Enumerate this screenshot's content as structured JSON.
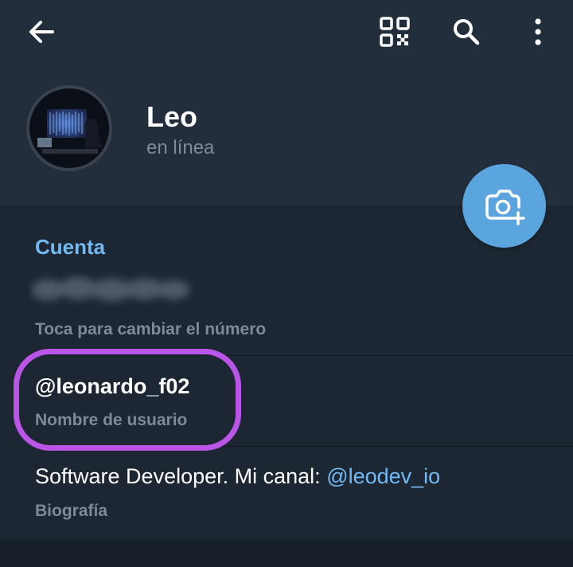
{
  "toolbar": {
    "back_icon": "arrow-left-icon",
    "qr_icon": "qr-code-icon",
    "search_icon": "search-icon",
    "more_icon": "more-vertical-icon"
  },
  "profile": {
    "name": "Leo",
    "status": "en línea",
    "avatar_icon": "avatar-photo"
  },
  "fab": {
    "icon": "camera-add-icon"
  },
  "account": {
    "section_title": "Cuenta",
    "phone_hint": "Toca para cambiar el número",
    "username": "@leonardo_f02",
    "username_label": "Nombre de usuario",
    "bio_text": "Software Developer. Mi canal: ",
    "bio_link": "@leodev_io",
    "bio_label": "Biografía"
  },
  "colors": {
    "background": "#1d2733",
    "header": "#232e3c",
    "accent": "#71baf4",
    "fab": "#5ba5de",
    "highlight": "#bb55e8"
  }
}
